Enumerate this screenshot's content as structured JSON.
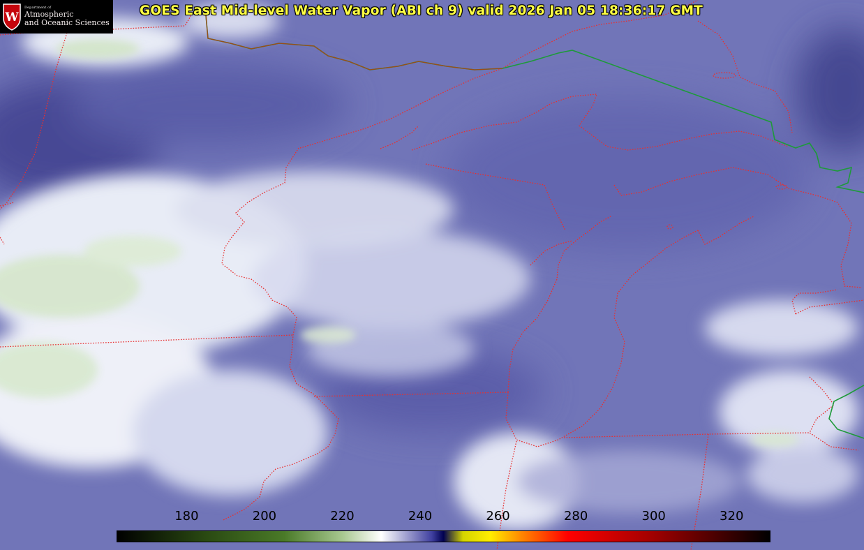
{
  "title": "GOES East Mid-level Water Vapor (ABI ch 9)  valid 2026 Jan 05 18:36:17 GMT",
  "logo": {
    "crest_icon": "uw-crest-icon",
    "department": "Department of",
    "name_line1": "Atmospheric",
    "name_line2": "and Oceanic Sciences",
    "crest_color": "#c5050c"
  },
  "colorbar": {
    "tick_labels": [
      "180",
      "200",
      "220",
      "240",
      "260",
      "280",
      "300",
      "320"
    ],
    "units_min": 162,
    "units_max": 330,
    "gradient_stops": [
      {
        "value": 162,
        "color": "#000000"
      },
      {
        "value": 185,
        "color": "#2a4a12"
      },
      {
        "value": 205,
        "color": "#4a7a28"
      },
      {
        "value": 220,
        "color": "#a8c890"
      },
      {
        "value": 230,
        "color": "#ffffff"
      },
      {
        "value": 243,
        "color": "#4040a0"
      },
      {
        "value": 246,
        "color": "#000050"
      },
      {
        "value": 251,
        "color": "#d4d400"
      },
      {
        "value": 258,
        "color": "#ffee00"
      },
      {
        "value": 266,
        "color": "#ff8800"
      },
      {
        "value": 278,
        "color": "#ff0000"
      },
      {
        "value": 300,
        "color": "#a00000"
      },
      {
        "value": 330,
        "color": "#000000"
      }
    ]
  },
  "map": {
    "background_color": "#6e72b4",
    "cloud_color": "#ffffff",
    "cold_cloud_color": "#d8ecd0",
    "state_border_color": "#e83030",
    "country_border_color": "#1e9a3a"
  }
}
